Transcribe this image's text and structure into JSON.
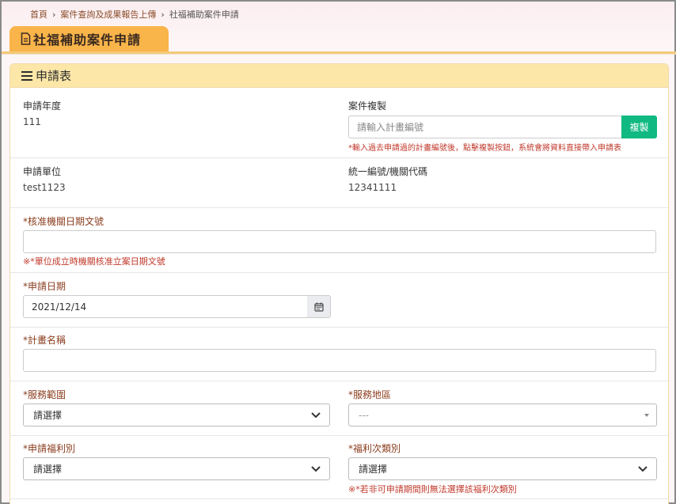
{
  "breadcrumb": [
    "首頁",
    "案件查詢及成果報告上傳",
    "社福補助案件申請"
  ],
  "page_title": "社福補助案件申請",
  "panel_title": "申請表",
  "fields": {
    "apply_year": {
      "label": "申請年度",
      "value": "111"
    },
    "case_copy": {
      "label": "案件複製",
      "placeholder": "請輸入計畫編號",
      "button": "複製",
      "note": "*輸入過去申請過的計畫編號後，點擊複製按鈕，系統會將資料直接帶入申請表"
    },
    "apply_unit": {
      "label": "申請單位",
      "value": "test1123"
    },
    "tax_id": {
      "label": "統一編號/機關代碼",
      "value": "12341111"
    },
    "approval_doc": {
      "label": "*核准機關日期文號",
      "value": "",
      "note": "※*單位成立時機關核准立案日期文號"
    },
    "apply_date": {
      "label": "*申請日期",
      "value": "2021/12/14"
    },
    "plan_name": {
      "label": "*計畫名稱",
      "value": ""
    },
    "service_scope": {
      "label": "*服務範圍",
      "selected": "請選擇"
    },
    "service_area": {
      "label": "*服務地區",
      "selected": "---"
    },
    "welfare_type": {
      "label": "*申請福利別",
      "selected": "請選擇"
    },
    "welfare_subtype": {
      "label": "*福利次類別",
      "selected": "請選擇",
      "note": "※*若非可申請期間則無法選擇該福利次類別"
    }
  },
  "icons": {
    "page": "document-icon",
    "panel": "list-icon",
    "date": "calendar-icon",
    "select": "chevron-down-icon",
    "breadcrumb_sep": "chevron-right-icon"
  },
  "colors": {
    "tab": "#f9b44a",
    "panel_header": "#fce7a8",
    "copy_button": "#10b981",
    "required_label": "#8b3d1e",
    "note": "#c0392b"
  }
}
